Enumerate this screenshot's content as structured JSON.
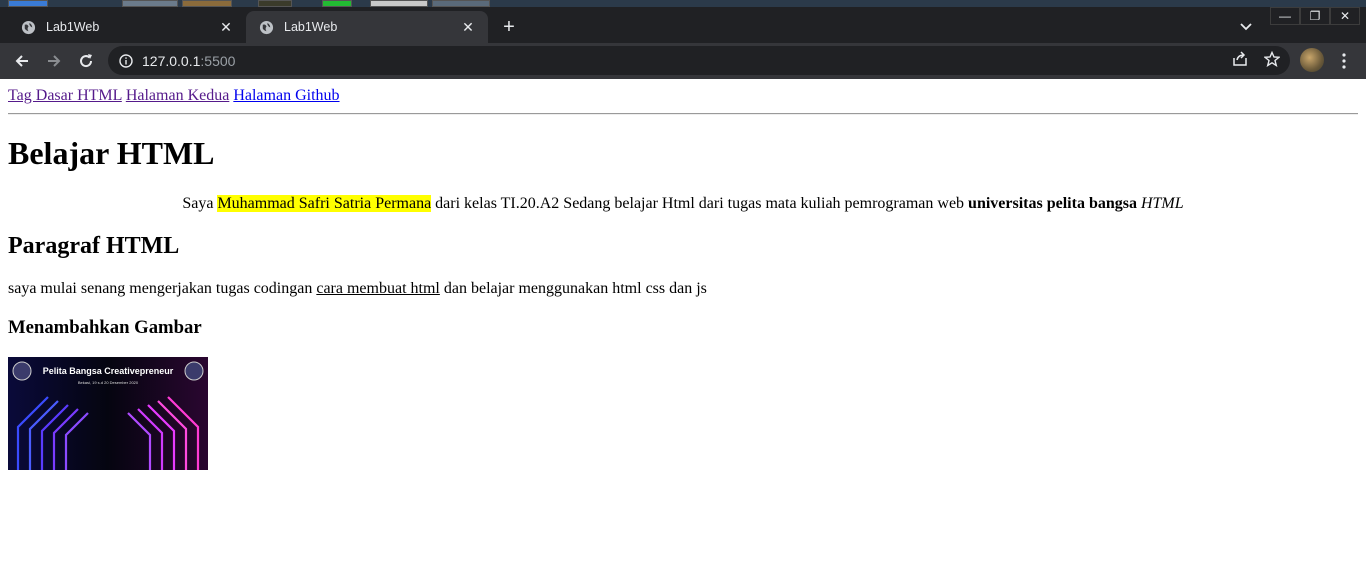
{
  "browser": {
    "tabs": [
      {
        "title": "Lab1Web",
        "active": false
      },
      {
        "title": "Lab1Web",
        "active": true
      }
    ],
    "address": {
      "host": "127.0.0.1",
      "port": ":5500"
    },
    "accent_color": "#35363a",
    "icons": [
      "back-icon",
      "forward-icon",
      "reload-icon",
      "info-icon",
      "share-icon",
      "star-icon",
      "menu-icon",
      "new-tab-icon",
      "tab-search-icon",
      "minimize-icon",
      "restore-icon",
      "close-window-icon"
    ]
  },
  "page": {
    "nav_links": [
      "Tag Dasar HTML",
      "Halaman Kedua",
      "Halaman Github"
    ],
    "heading": "Belajar HTML",
    "intro": {
      "prefix": "Saya ",
      "highlight": "Muhammad Safri Satria Permana",
      "middle": " dari kelas TI.20.A2 Sedang belajar Html dari tugas mata kuliah pemrograman web ",
      "bold": "universitas pelita bangsa",
      "italic": "HTML"
    },
    "subheading": "Paragraf HTML",
    "paragraph": {
      "before": "saya mulai senang mengerjakan tugas codingan ",
      "underlined": "cara membuat html",
      "after": " dan belajar menggunakan html css dan js"
    },
    "image_heading": "Menambahkan Gambar",
    "banner": {
      "title": "Pelita Bangsa Creativepreneur",
      "date": "Bekasi, 19 s.d 20 Desember 2020"
    }
  }
}
